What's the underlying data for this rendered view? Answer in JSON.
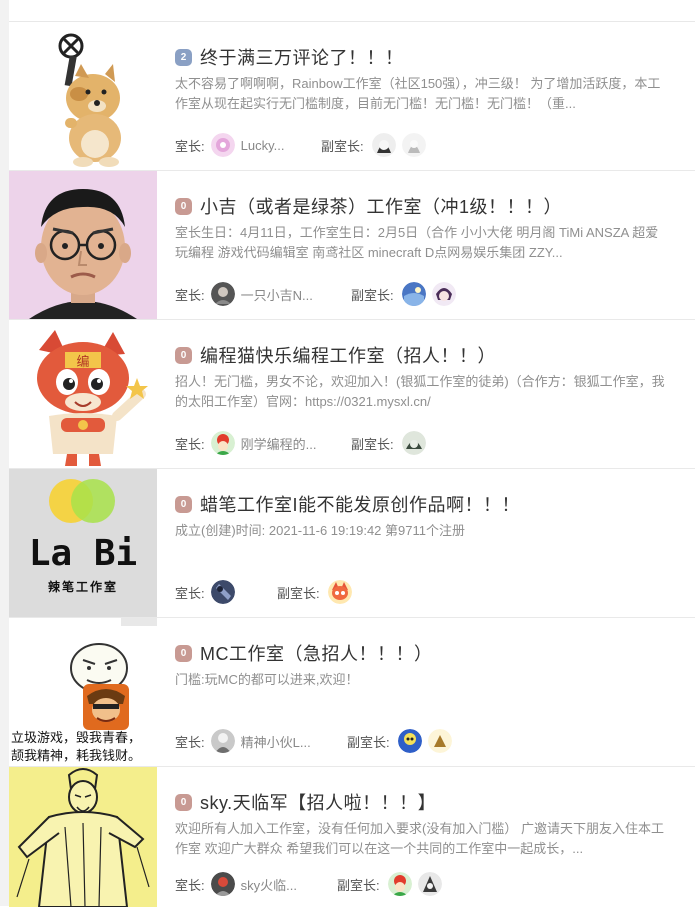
{
  "labels": {
    "owner": "室长:",
    "deputy": "副室长:"
  },
  "studios": [
    {
      "level": "2",
      "title": "终于满三万评论了！！！",
      "desc": "太不容易了啊啊啊，Rainbow工作室（社区150强），冲三级！ 为了增加活跃度，本工作室从现在起实行无门槛制度，目前无门槛！无门槛！无门槛！（重...",
      "owner_name": "Lucky...",
      "thumb_icon": "doge-exo-icon"
    },
    {
      "level": "0",
      "title": "小吉（或者是绿茶）工作室（冲1级！！！）",
      "desc": "室长生日：4月11日，工作室生日：2月5日（合作 小小大佬 明月阁 TiMi ANSZA 超爱玩编程 游戏代码编辑室 南鸢社区 minecraft D点网易娱乐集团 ZZY...",
      "owner_name": "一只小吉N...",
      "thumb_icon": "glasses-man-icon"
    },
    {
      "level": "0",
      "title": "编程猫快乐编程工作室（招人！！）",
      "desc": "招人！无门槛，男女不论，欢迎加入！(银狐工作室的徒弟)（合作方：银狐工作室，我的太阳工作室）官网：https://0321.mysxl.cn/",
      "owner_name": "刚学编程的...",
      "thumb_icon": "coding-cat-icon"
    },
    {
      "level": "0",
      "title": "蜡笔工作室I能不能发原创作品啊！！！",
      "desc": "成立(创建)时间: 2021-11-6 19:19:42 第9711个注册",
      "owner_name": "",
      "thumb_icon": "labi-logo-icon",
      "logo_text": "La Bi",
      "logo_sub": "辣笔工作室"
    },
    {
      "level": "0",
      "title": "MC工作室（急招人！！！）",
      "desc": "门槛:玩MC的都可以进来,欢迎！",
      "owner_name": "精神小伙L...",
      "thumb_icon": "meme-face-icon",
      "meme_line1": "立圾游戏，毁我青春，",
      "meme_line2": "颉我精神，耗我钱财。"
    },
    {
      "level": "0",
      "title": "sky.天临军【招人啦！！！】",
      "desc": "欢迎所有人加入工作室，没有任何加入要求(没有加入门槛） 广邀请天下朋友入住本工作室 欢迎广大群众 希望我们可以在这一个共同的工作室中一起成长，...",
      "owner_name": "sky火临...",
      "thumb_icon": "sketch-figure-icon"
    }
  ]
}
